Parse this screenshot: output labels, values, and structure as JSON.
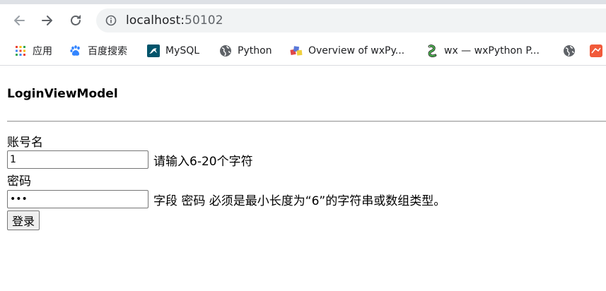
{
  "browser": {
    "url_host": "localhost:",
    "url_port": "50102",
    "bookmarks": [
      {
        "label": "应用",
        "icon": "apps-grid-icon"
      },
      {
        "label": "百度搜索",
        "icon": "baidu-paw-icon"
      },
      {
        "label": "MySQL",
        "icon": "mysql-icon"
      },
      {
        "label": "Python",
        "icon": "globe-icon"
      },
      {
        "label": "Overview of wxPy...",
        "icon": "wxpython-icon"
      },
      {
        "label": "wx — wxPython P...",
        "icon": "snake-icon"
      },
      {
        "label": "",
        "icon": "globe-icon"
      },
      {
        "label": "",
        "icon": "red-bookmark-icon"
      }
    ]
  },
  "page": {
    "title": "LoginViewModel",
    "account_label": "账号名",
    "account_value": "1",
    "account_hint": "请输入6-20个字符",
    "password_label": "密码",
    "password_value": "abc",
    "password_hint": "字段 密码 必须是最小长度为“6”的字符串或数组类型。",
    "submit_label": "登录"
  },
  "colors": {
    "omnibox_bg": "#f1f3f4",
    "icon_gray": "#5f6368"
  }
}
